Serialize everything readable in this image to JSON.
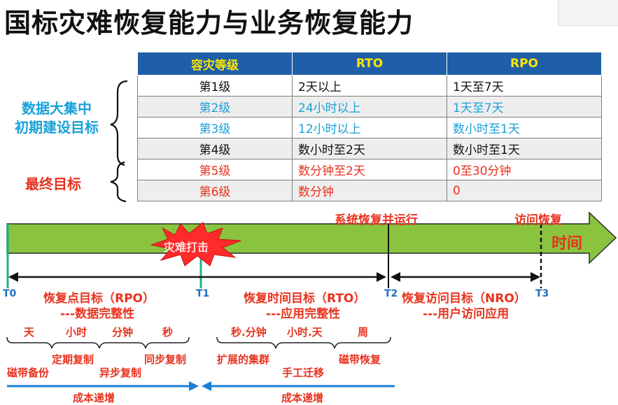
{
  "title": "国标灾难恢复能力与业务恢复能力",
  "table": {
    "headers": [
      "容灾等级",
      "RTO",
      "RPO"
    ],
    "rows": [
      {
        "level": "第1级",
        "rto": "2天以上",
        "rpo": "1天至7天",
        "color": "black"
      },
      {
        "level": "第2级",
        "rto": "24小时以上",
        "rpo": "1天至7天",
        "color": "blue"
      },
      {
        "level": "第3级",
        "rto": "12小时以上",
        "rpo": "数小时至1天",
        "color": "blue"
      },
      {
        "level": "第4级",
        "rto": "数小时至2天",
        "rpo": "数小时至1天",
        "color": "black"
      },
      {
        "level": "第5级",
        "rto": "数分钟至2天",
        "rpo": "0至30分钟",
        "color": "red"
      },
      {
        "level": "第6级",
        "rto": "数分钟",
        "rpo": "0",
        "color": "red"
      }
    ]
  },
  "side_labels": {
    "initial_line1": "数据大集中",
    "initial_line2": "初期建设目标",
    "final": "最终目标"
  },
  "timeline": {
    "time_label": "时间",
    "disaster": "灾难打击",
    "system_recovery": "系统恢复并运行",
    "access_recovery": "访问恢复",
    "t0": "T0",
    "t1": "T1",
    "t2": "T2",
    "t3": "T3",
    "rpo_title": "恢复点目标（RPO）",
    "rpo_sub": "---数据完整性",
    "rto_title": "恢复时间目标（RTO）",
    "rto_sub": "---应用完整性",
    "nro_title": "恢复访问目标（NRO）",
    "nro_sub": "---用户访问应用"
  },
  "scale_left": {
    "units": [
      "天",
      "小时",
      "分钟",
      "秒"
    ],
    "methods": [
      "磁带备份",
      "定期复制",
      "异步复制",
      "同步复制"
    ],
    "cost": "成本递增"
  },
  "scale_right": {
    "units": [
      "秒.分钟",
      "小时.天",
      "周"
    ],
    "methods": [
      "扩展的集群",
      "手工迁移",
      "磁带恢复"
    ],
    "cost": "成本递增"
  },
  "colors": {
    "header_bg": "#1f5fa8",
    "header_text": "#ffe600",
    "arrow_green": "#8ac43f",
    "accent_red": "#e8321e",
    "accent_blue": "#1aa0d8"
  }
}
